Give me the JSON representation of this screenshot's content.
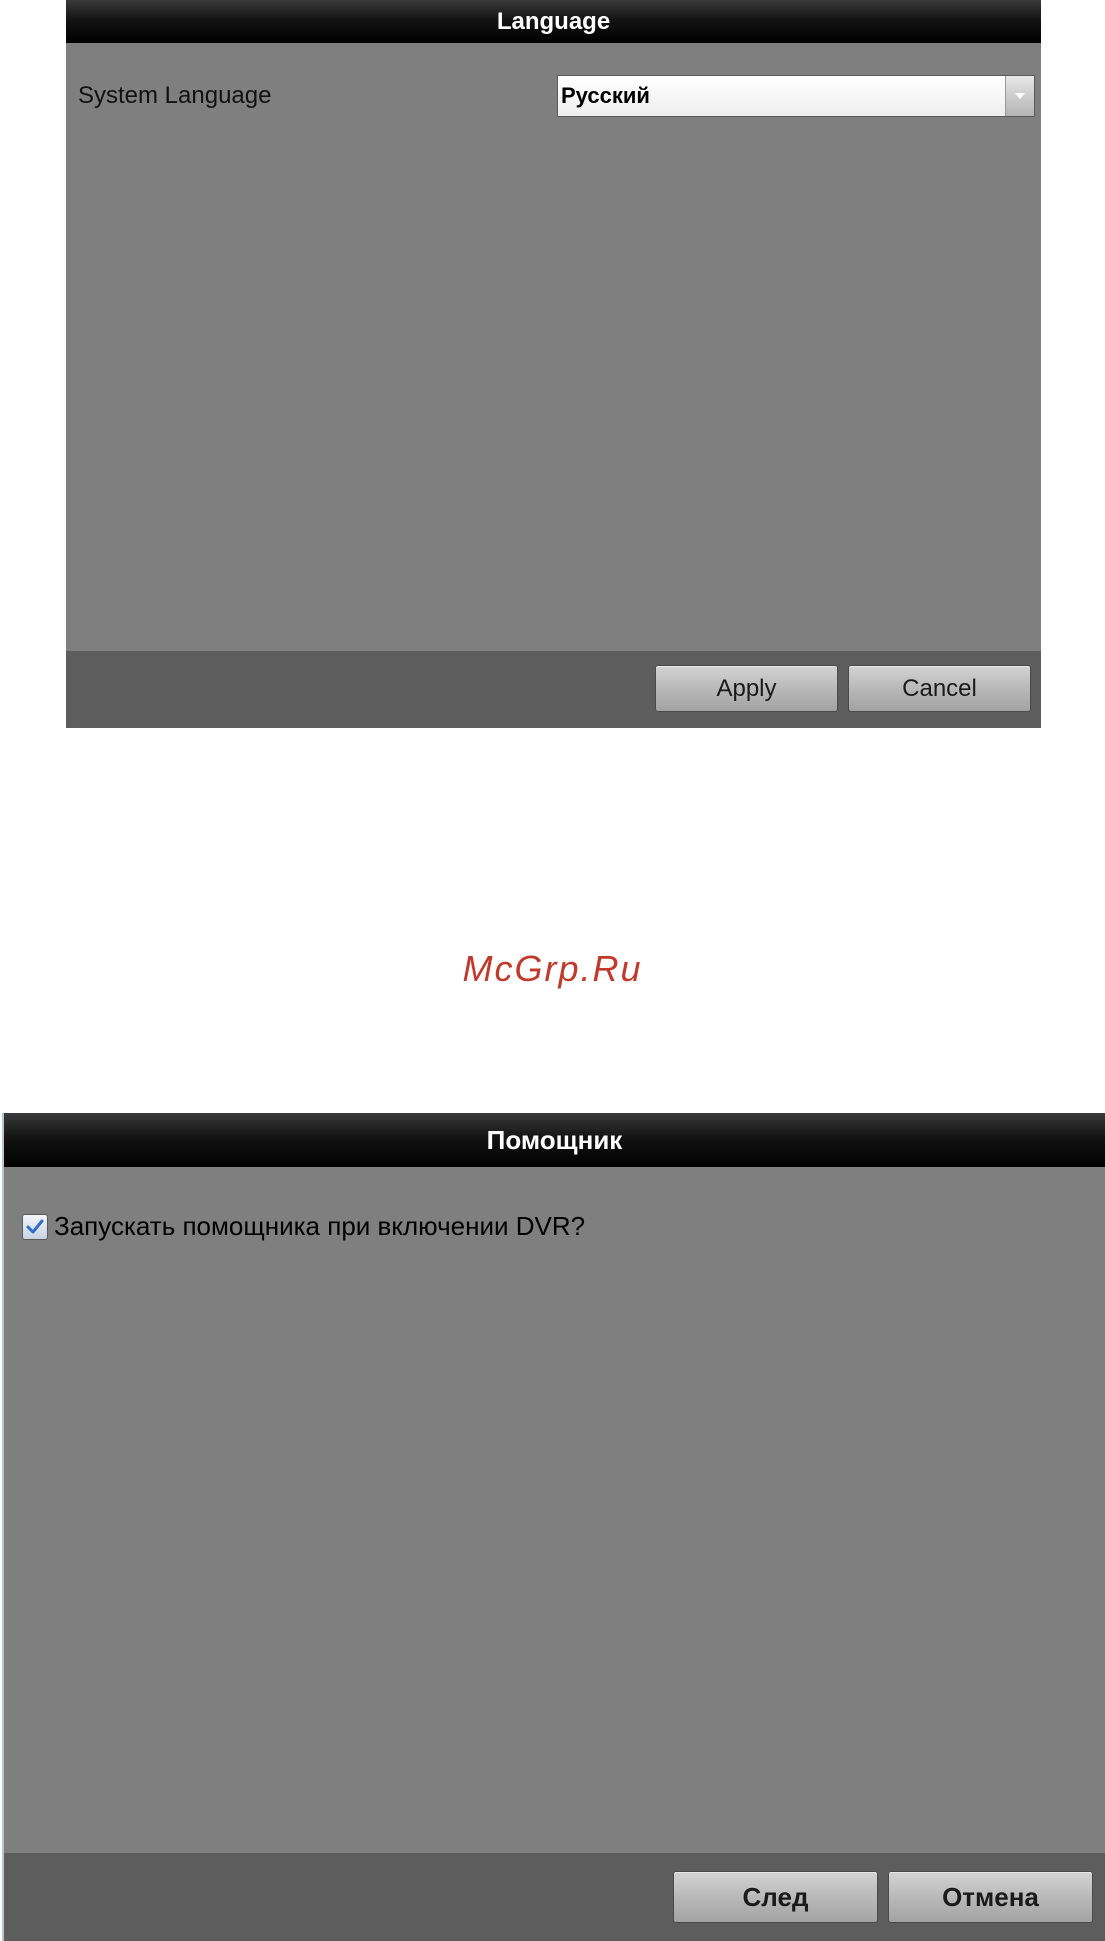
{
  "language_dialog": {
    "title": "Language",
    "system_language_label": "System Language",
    "system_language_value": "Русский",
    "apply_label": "Apply",
    "cancel_label": "Cancel"
  },
  "watermark": "McGrp.Ru",
  "wizard_dialog": {
    "title": "Помощник",
    "start_wizard_checkbox_label": "Запускать помощника при включении DVR?",
    "start_wizard_checked": true,
    "next_label": "След",
    "cancel_label": "Отмена"
  },
  "colors": {
    "panel_background": "#7f7f7f",
    "footer_background": "#5d5d5d",
    "title_bar": "#000000",
    "watermark": "#c0392b"
  },
  "icons": {
    "select_arrow": "chevron-down-icon",
    "checkbox_mark": "checkmark-icon"
  }
}
